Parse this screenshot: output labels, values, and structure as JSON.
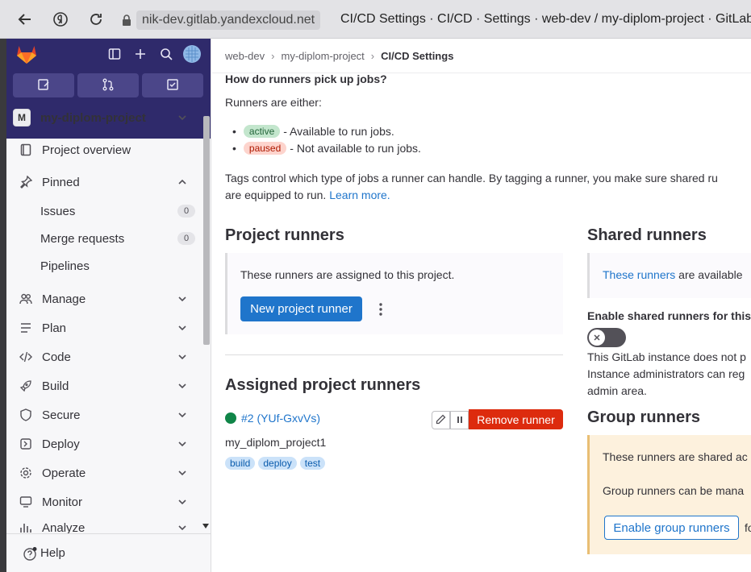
{
  "browser": {
    "url": "nik-dev.gitlab.yandexcloud.net",
    "page_title": "CI/CD Settings · CI/CD · Settings · web-dev / my-diplom-project · GitLab"
  },
  "sidebar": {
    "project_avatar_letter": "M",
    "project_name": "my-diplom-project",
    "overview": "Project overview",
    "pinned": "Pinned",
    "pinned_items": [
      {
        "label": "Issues",
        "count": "0"
      },
      {
        "label": "Merge requests",
        "count": "0"
      },
      {
        "label": "Pipelines"
      }
    ],
    "sections": [
      "Manage",
      "Plan",
      "Code",
      "Build",
      "Secure",
      "Deploy",
      "Operate",
      "Monitor",
      "Analyze"
    ],
    "help": "Help"
  },
  "breadcrumb": {
    "group": "web-dev",
    "project": "my-diplom-project",
    "current": "CI/CD Settings"
  },
  "content": {
    "how_heading": "How do runners pick up jobs?",
    "runners_either": "Runners are either:",
    "status_list": [
      {
        "badge": "active",
        "desc": "- Available to run jobs."
      },
      {
        "badge": "paused",
        "desc": "- Not available to run jobs."
      }
    ],
    "tags_line1": "Tags control which type of jobs a runner can handle. By tagging a runner, you make sure shared ru",
    "tags_line2": "are equipped to run.",
    "learn_more": "Learn more.",
    "project_runners": {
      "title": "Project runners",
      "info": "These runners are assigned to this project.",
      "new_button": "New project runner"
    },
    "assigned": {
      "title": "Assigned project runners",
      "runner_link": "#2 (YUf-GxvVs)",
      "runner_name": "my_diplom_project1",
      "tags": [
        "build",
        "deploy",
        "test"
      ],
      "remove_button": "Remove runner"
    },
    "shared_runners": {
      "title": "Shared runners",
      "link": "These runners",
      "info_rest": "are available",
      "enable_label": "Enable shared runners for this",
      "note_line1": "This GitLab instance does not p",
      "note_line2": "Instance administrators can reg",
      "note_line3": "admin area."
    },
    "group_runners": {
      "title": "Group runners",
      "info1": "These runners are shared ac",
      "info2": "Group runners can be mana",
      "enable_button": "Enable group runners",
      "trailing": "fo"
    }
  },
  "colors": {
    "sidebar_top": "#2f2a6b",
    "primary": "#1f75cb",
    "danger": "#dd2b0e",
    "online": "#108548"
  }
}
